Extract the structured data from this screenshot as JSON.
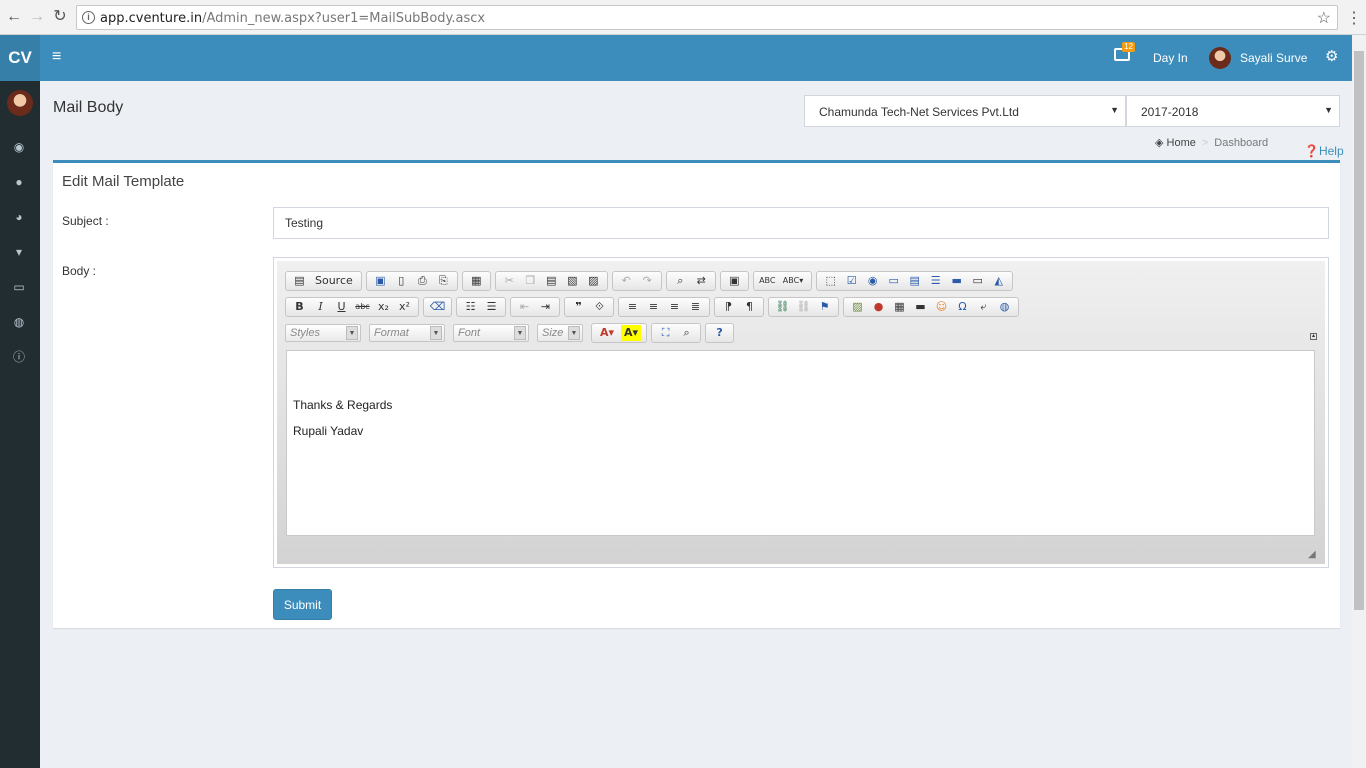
{
  "browser": {
    "url_host": "app.cventure.in",
    "url_path": "/Admin_new.aspx?user1=MailSubBody.ascx"
  },
  "header": {
    "logo": "CV",
    "notification_count": "12",
    "day_in_label": "Day In",
    "user_name": "Sayali Surve",
    "accent_color": "#3c8dbc"
  },
  "sidebar": {
    "items": [
      {
        "icon": "dashboard-icon"
      },
      {
        "icon": "user-icon"
      },
      {
        "icon": "pie-chart-icon"
      },
      {
        "icon": "cart-icon"
      },
      {
        "icon": "credit-card-icon"
      },
      {
        "icon": "globe-icon"
      },
      {
        "icon": "info-icon"
      }
    ]
  },
  "page": {
    "title": "Mail Body",
    "company_select": "Chamunda Tech-Net Services Pvt.Ltd",
    "year_select": "2017-2018"
  },
  "breadcrumb": {
    "home": "Home",
    "current": "Dashboard"
  },
  "help_label": "Help",
  "form": {
    "box_title": "Edit Mail Template",
    "subject_label": "Subject :",
    "subject_value": "Testing",
    "body_label": "Body :",
    "submit_label": "Submit"
  },
  "editor": {
    "source_label": "Source",
    "styles_placeholder": "Styles",
    "format_placeholder": "Format",
    "font_placeholder": "Font",
    "size_placeholder": "Size",
    "body_lines": [
      "Thanks & Regards",
      "Rupali Yadav"
    ]
  }
}
